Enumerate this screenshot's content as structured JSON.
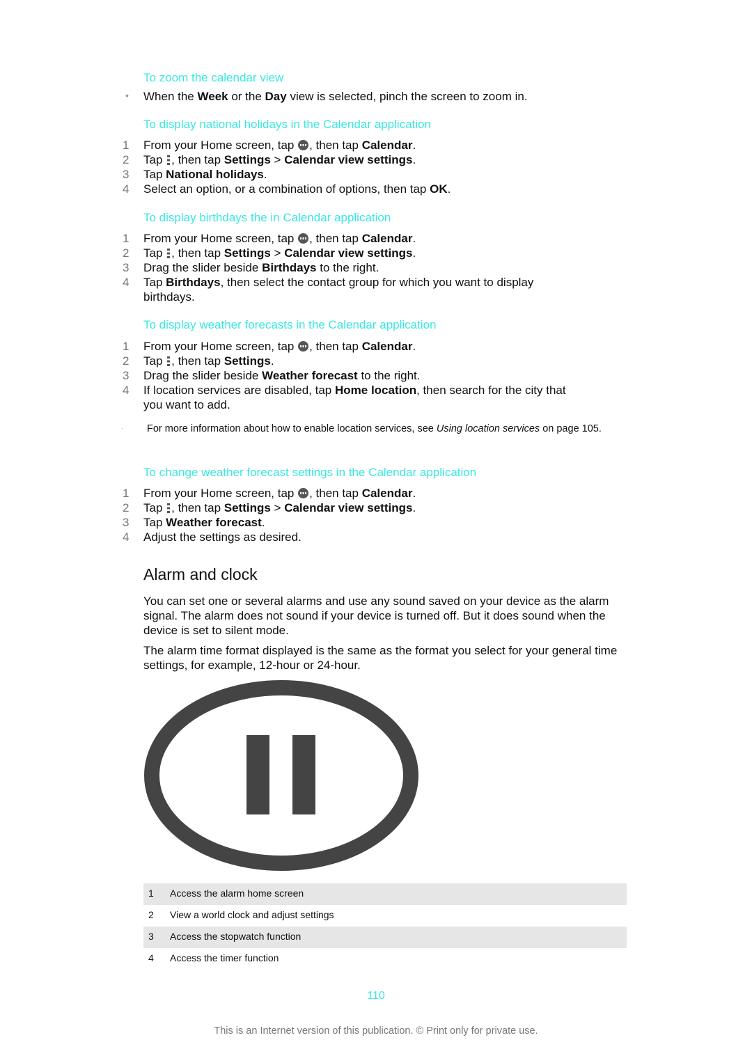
{
  "sections": [
    {
      "heading": "To zoom the calendar view"
    },
    {
      "heading": "To display national holidays in the Calendar application"
    },
    {
      "heading": "To display birthdays the in Calendar application"
    },
    {
      "heading": "To display weather forecasts in the Calendar application"
    },
    {
      "heading": "To change weather forecast settings in the Calendar application"
    }
  ],
  "zoom_bullet": {
    "p1": "When the ",
    "b1": "Week",
    "p2": " or the ",
    "b2": "Day",
    "p3": " view is selected, pinch the screen to zoom in."
  },
  "common": {
    "from_home": "From your Home screen, tap ",
    "then_tap": ", then tap ",
    "calendar": "Calendar",
    "period": ".",
    "tap": "Tap ",
    "settings": "Settings",
    "gt": " > ",
    "calendar_view_settings": "Calendar view settings",
    "icons": {
      "apps": "apps-grid-icon",
      "menu": "overflow-menu-icon"
    }
  },
  "holidays": {
    "s3_b": "National holidays",
    "s4_p": "Select an option, or a combination of options, then tap ",
    "s4_b": "OK"
  },
  "birthdays": {
    "s3_p1": "Drag the slider beside ",
    "s3_b": "Birthdays",
    "s3_p2": " to the right.",
    "s4_b": "Birthdays",
    "s4_p": ", then select the contact group for which you want to display birthdays."
  },
  "weather": {
    "s3_p1": "Drag the slider beside ",
    "s3_b": "Weather forecast",
    "s3_p2": " to the right.",
    "s4_p1": "If location services are disabled, tap ",
    "s4_b": "Home location",
    "s4_p2": ", then search for the city that you want to add.",
    "note_p1": "For more information about how to enable location services, see ",
    "note_i": "Using location services",
    "note_p2": " on page 105."
  },
  "weather_settings": {
    "s3_b": "Weather forecast",
    "s4": "Adjust the settings as desired."
  },
  "step_numbers": [
    "1",
    "2",
    "3",
    "4"
  ],
  "alarm": {
    "title": "Alarm and clock",
    "para1": "You can set one or several alarms and use any sound saved on your device as the alarm signal. The alarm does not sound if your device is turned off. But it does sound when the device is set to silent mode.",
    "para2": "The alarm time format displayed is the same as the format you select for your general time settings, for example, 12-hour or 24-hour.",
    "illustration_icon": "pause-button-icon",
    "legend": [
      {
        "n": "1",
        "text": "Access the alarm home screen"
      },
      {
        "n": "2",
        "text": "View a world clock and adjust settings"
      },
      {
        "n": "3",
        "text": "Access the stopwatch function"
      },
      {
        "n": "4",
        "text": "Access the timer function"
      }
    ]
  },
  "page_number": "110",
  "footer": "This is an Internet version of this publication. © Print only for private use.",
  "colors": {
    "heading": "#3ae8e0",
    "text": "#111111",
    "legend_shade": "#e6e6e6"
  }
}
